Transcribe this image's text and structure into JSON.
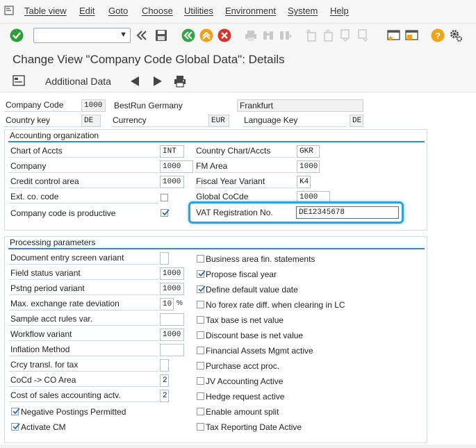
{
  "menu": {
    "items": [
      "Table view",
      "Edit",
      "Goto",
      "Choose",
      "Utilities",
      "Environment",
      "System",
      "Help"
    ]
  },
  "toolbar": {
    "command_value": "",
    "icons": [
      "green-check-icon",
      "double-left-icon",
      "save-icon",
      "back-icon",
      "exit-icon",
      "cancel-icon",
      "print-icon",
      "find-icon",
      "find-next-icon",
      "first-page-icon",
      "previous-page-icon",
      "next-page-icon",
      "last-page-icon",
      "create-session-icon",
      "shortcut-icon",
      "help-icon",
      "customize-layout-icon"
    ]
  },
  "title": "Change View \"Company Code Global Data\": Details",
  "app_toolbar": {
    "additional_data_label": "Additional Data"
  },
  "header": {
    "company_code_label": "Company Code",
    "company_code_value": "1000",
    "company_name": "BestRun Germany",
    "city": "Frankfurt",
    "country_key_label": "Country key",
    "country_key_value": "DE",
    "currency_label": "Currency",
    "currency_value": "EUR",
    "language_key_label": "Language Key",
    "language_key_value": "DE"
  },
  "accounting_org": {
    "title": "Accounting organization",
    "chart_of_accts_label": "Chart of Accts",
    "chart_of_accts_value": "INT",
    "company_label": "Company",
    "company_value": "1000",
    "credit_control_label": "Credit control area",
    "credit_control_value": "1000",
    "ext_co_code_label": "Ext. co. code",
    "ext_co_code_checked": false,
    "productive_label": "Company code is productive",
    "productive_checked": true,
    "country_chart_label": "Country Chart/Accts",
    "country_chart_value": "GKR",
    "fm_area_label": "FM Area",
    "fm_area_value": "1000",
    "fiscal_year_variant_label": "Fiscal Year Variant",
    "fiscal_year_variant_value": "K4",
    "global_cocde_label": "Global CoCde",
    "global_cocde_value": "1000",
    "vat_reg_label": "VAT Registration No.",
    "vat_reg_value": "DE12345678"
  },
  "processing": {
    "title": "Processing parameters",
    "left": [
      {
        "label": "Document entry screen variant",
        "value": ""
      },
      {
        "label": "Field status variant",
        "value": "1000"
      },
      {
        "label": "Pstng period variant",
        "value": "1000"
      },
      {
        "label": "Max. exchange rate deviation",
        "value": "10",
        "unit": "%"
      },
      {
        "label": "Sample acct rules var.",
        "value": ""
      },
      {
        "label": "Workflow variant",
        "value": "1000"
      },
      {
        "label": "Inflation Method",
        "value": ""
      },
      {
        "label": "Crcy transl. for tax",
        "value": ""
      },
      {
        "label": "CoCd -> CO Area",
        "value": "2"
      },
      {
        "label": "Cost of sales accounting actv.",
        "value": "2"
      }
    ],
    "left_checks": [
      {
        "label": "Negative Postings Permitted",
        "checked": true
      },
      {
        "label": "Activate CM",
        "checked": true
      }
    ],
    "right_checks": [
      {
        "label": "Business area fin. statements",
        "checked": false
      },
      {
        "label": "Propose fiscal year",
        "checked": true
      },
      {
        "label": "Define default value date",
        "checked": true
      },
      {
        "label": "No forex rate diff. when clearing in LC",
        "checked": false
      },
      {
        "label": "Tax base is net value",
        "checked": false
      },
      {
        "label": "Discount base is net value",
        "checked": false
      },
      {
        "label": "Financial Assets Mgmt active",
        "checked": false
      },
      {
        "label": "Purchase acct proc.",
        "checked": false
      },
      {
        "label": "JV Accounting Active",
        "checked": false
      },
      {
        "label": "Hedge request active",
        "checked": false
      },
      {
        "label": "Enable amount split",
        "checked": false
      },
      {
        "label": "Tax Reporting Date Active",
        "checked": false
      }
    ]
  },
  "colors": {
    "accent_blue": "#2d8bd0",
    "highlight": "#29a3e3",
    "ok_green": "#2e9e3a",
    "cancel_red": "#d9342b",
    "back_green": "#35a446",
    "exit_orange": "#f0a11a",
    "help_orange": "#f3a313"
  }
}
